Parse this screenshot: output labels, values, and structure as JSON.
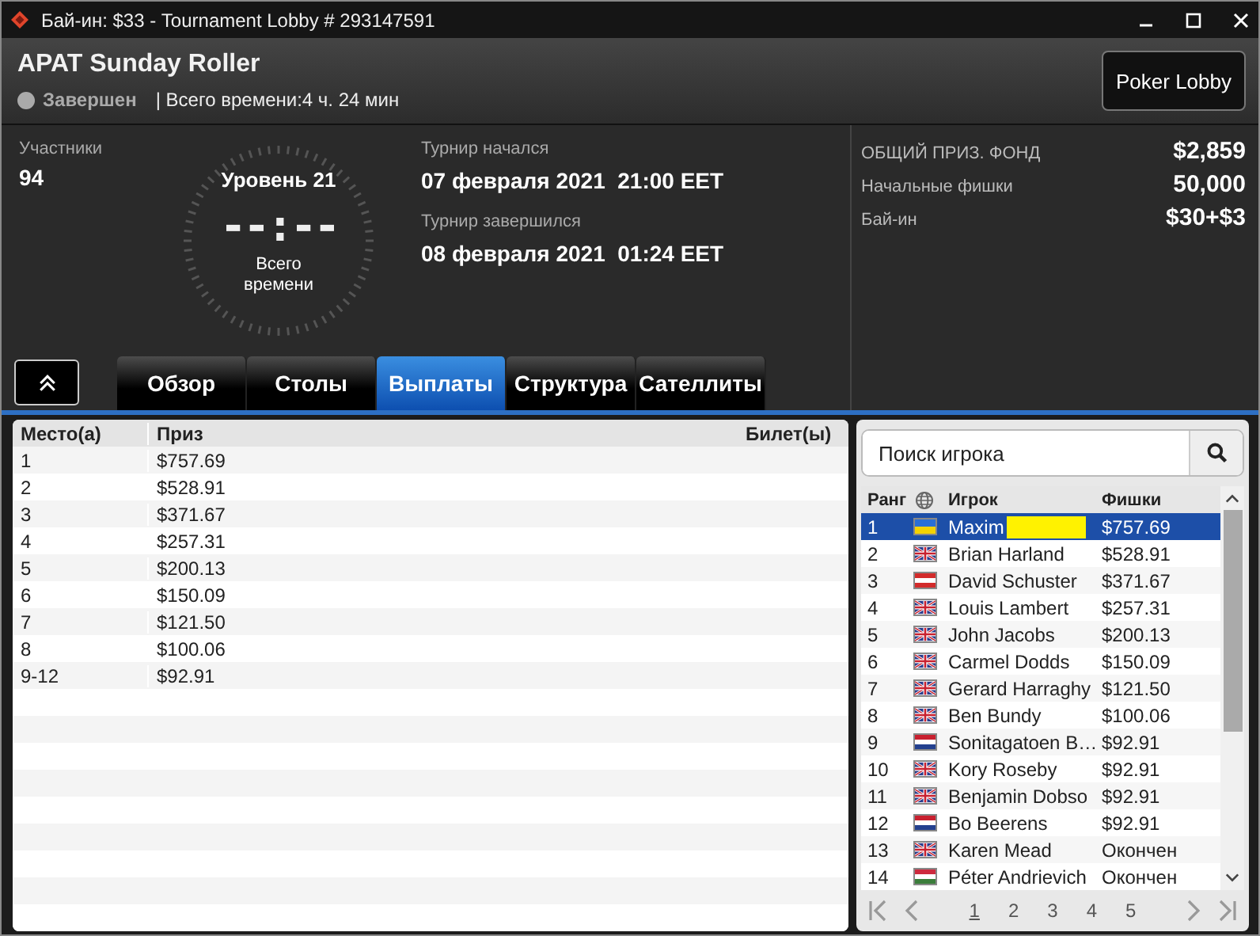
{
  "window": {
    "title": "Бай-ин: $33 - Tournament Lobby # 293147591"
  },
  "header": {
    "title": "APAT Sunday Roller",
    "status": "Завершен",
    "duration": "| Всего времени:4 ч. 24 мин",
    "button": "Poker Lobby"
  },
  "info": {
    "participants_label": "Участники",
    "participants": "94",
    "level": "Уровень 21",
    "clock": "--:--",
    "clock_label": "Всего времени",
    "started_label": "Турнир начался",
    "started": "07 февраля 2021  21:00 EET",
    "ended_label": "Турнир завершился",
    "ended": "08 февраля 2021  01:24 EET",
    "stats": [
      {
        "label": "ОБЩИЙ ПРИЗ. ФОНД",
        "value": "$2,859"
      },
      {
        "label": "Начальные фишки",
        "value": "50,000"
      },
      {
        "label": "Бай-ин",
        "value": "$30+$3"
      }
    ]
  },
  "tabs": [
    {
      "label": "Обзор",
      "selected": false
    },
    {
      "label": "Столы",
      "selected": false
    },
    {
      "label": "Выплаты",
      "selected": true
    },
    {
      "label": "Структура",
      "selected": false
    },
    {
      "label": "Сателлиты",
      "selected": false
    }
  ],
  "payouts": {
    "columns": [
      "Место(а)",
      "Приз",
      "Билет(ы)"
    ],
    "rows": [
      {
        "place": "1",
        "prize": "$757.69"
      },
      {
        "place": "2",
        "prize": "$528.91"
      },
      {
        "place": "3",
        "prize": "$371.67"
      },
      {
        "place": "4",
        "prize": "$257.31"
      },
      {
        "place": "5",
        "prize": "$200.13"
      },
      {
        "place": "6",
        "prize": "$150.09"
      },
      {
        "place": "7",
        "prize": "$121.50"
      },
      {
        "place": "8",
        "prize": "$100.06"
      },
      {
        "place": "9-12",
        "prize": "$92.91"
      }
    ]
  },
  "players": {
    "search": {
      "placeholder": "Поиск игрока"
    },
    "columns": [
      "Ранг",
      "Игрок",
      "Фишки"
    ],
    "rows": [
      {
        "rank": "1",
        "kind": "ua",
        "name": "Maxim",
        "chips": "$757.69",
        "selected": true,
        "redacted": true
      },
      {
        "rank": "2",
        "kind": "gb",
        "name": "Brian Harland",
        "chips": "$528.91",
        "selected": false,
        "redacted": false
      },
      {
        "rank": "3",
        "kind": "at",
        "name": "David Schuster",
        "chips": "$371.67",
        "selected": false,
        "redacted": false
      },
      {
        "rank": "4",
        "kind": "gb",
        "name": "Louis Lambert",
        "chips": "$257.31",
        "selected": false,
        "redacted": false
      },
      {
        "rank": "5",
        "kind": "gb",
        "name": "John Jacobs",
        "chips": "$200.13",
        "selected": false,
        "redacted": false
      },
      {
        "rank": "6",
        "kind": "gb",
        "name": "Carmel Dodds",
        "chips": "$150.09",
        "selected": false,
        "redacted": false
      },
      {
        "rank": "7",
        "kind": "gb",
        "name": "Gerard Harraghy",
        "chips": "$121.50",
        "selected": false,
        "redacted": false
      },
      {
        "rank": "8",
        "kind": "gb",
        "name": "Ben Bundy",
        "chips": "$100.06",
        "selected": false,
        "redacted": false
      },
      {
        "rank": "9",
        "kind": "nl",
        "name": "Sonitagatoen B…",
        "chips": "$92.91",
        "selected": false,
        "redacted": false
      },
      {
        "rank": "10",
        "kind": "gb",
        "name": "Kory Roseby",
        "chips": "$92.91",
        "selected": false,
        "redacted": false
      },
      {
        "rank": "11",
        "kind": "gb",
        "name": "Benjamin Dobso",
        "chips": "$92.91",
        "selected": false,
        "redacted": false
      },
      {
        "rank": "12",
        "kind": "nl",
        "name": "Bo Beerens",
        "chips": "$92.91",
        "selected": false,
        "redacted": false
      },
      {
        "rank": "13",
        "kind": "gb",
        "name": "Karen Mead",
        "chips": "Окончен",
        "selected": false,
        "redacted": false
      },
      {
        "rank": "14",
        "kind": "hu",
        "name": "Péter Andrievich",
        "chips": "Окончен",
        "selected": false,
        "redacted": false
      }
    ],
    "pages": [
      {
        "label": "1",
        "selected": true
      },
      {
        "label": "2",
        "selected": false
      },
      {
        "label": "3",
        "selected": false
      },
      {
        "label": "4",
        "selected": false
      },
      {
        "label": "5",
        "selected": false
      }
    ]
  }
}
